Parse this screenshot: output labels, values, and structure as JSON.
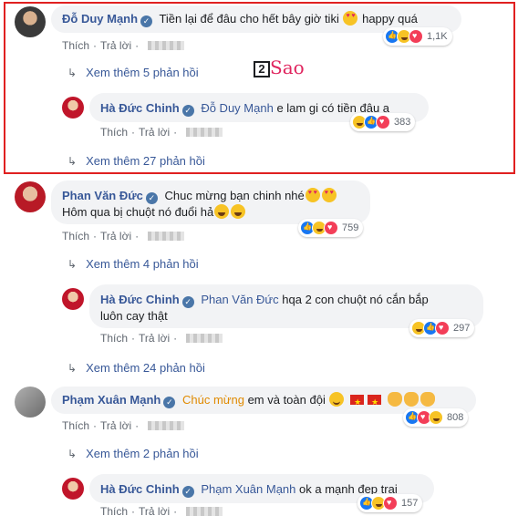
{
  "watermark": {
    "box": "2",
    "text": "Sao"
  },
  "common": {
    "like": "Thích",
    "reply": "Trả lời"
  },
  "c1": {
    "author": "Đỗ Duy Mạnh",
    "text": "Tiền lại để đâu cho hết bây giờ tiki",
    "text_after": "happy quá",
    "reactions": [
      "like",
      "haha",
      "love"
    ],
    "count": "1,1K",
    "more": "Xem thêm 5 phản hồi"
  },
  "r1": {
    "author": "Hà Đức Chinh",
    "mention": "Đỗ Duy Mạnh",
    "text": "e lam gi có tiền đâu ạ",
    "reactions": [
      "haha",
      "like",
      "love"
    ],
    "count": "383",
    "more": "Xem thêm 27 phản hồi"
  },
  "c2": {
    "author": "Phan Văn Đức",
    "text": "Chuc mừng bạn chinh nhé",
    "line2": "Hôm qua bị chuột nó đuổi hả",
    "reactions": [
      "like",
      "haha",
      "love"
    ],
    "count": "759",
    "more": "Xem thêm 4 phản hồi"
  },
  "r2": {
    "author": "Hà Đức Chinh",
    "mention": "Phan Văn Đức",
    "text": "hqa 2 con chuột nó cắn bắp",
    "line2": "luôn cay thật",
    "reactions": [
      "haha",
      "like",
      "love"
    ],
    "count": "297",
    "more": "Xem thêm 24 phản hồi"
  },
  "c3": {
    "author": "Phạm Xuân Mạnh",
    "highlight": "Chúc mừng",
    "text": "em và toàn đội",
    "reactions": [
      "like",
      "love",
      "haha"
    ],
    "count": "808",
    "more": "Xem thêm 2 phản hồi"
  },
  "r3": {
    "author": "Hà Đức Chinh",
    "mention": "Phạm Xuân Mạnh",
    "text": "ok a mạnh đẹp trai",
    "reactions": [
      "like",
      "haha",
      "love"
    ],
    "count": "157"
  },
  "colors": {
    "link": "#385898",
    "highlight_border": "#e02020",
    "bubble": "#f2f3f5",
    "gold_text": "#e08a00"
  }
}
